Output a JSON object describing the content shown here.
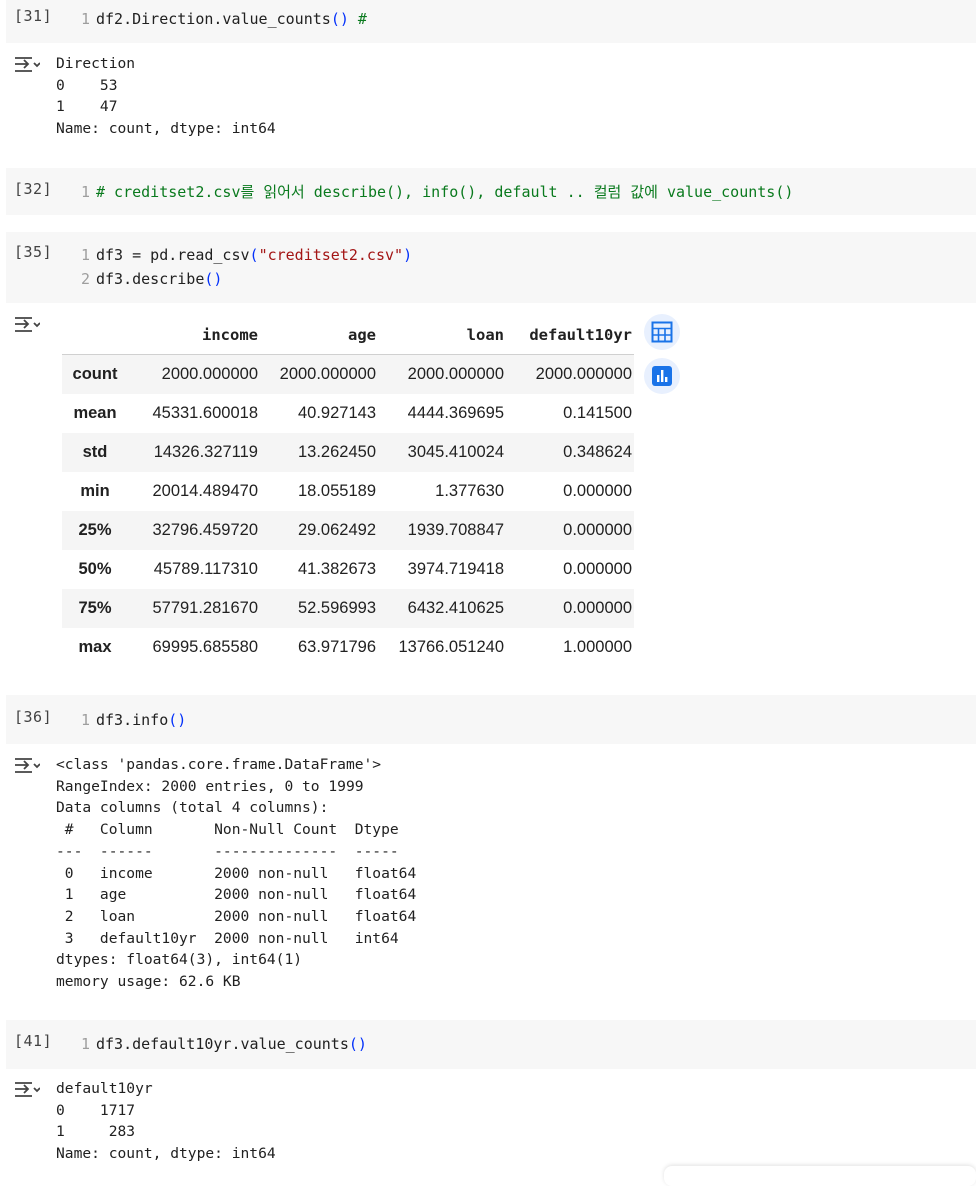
{
  "cells": [
    {
      "id": "c31",
      "exec_count": "[31]",
      "code": [
        {
          "n": "1",
          "parts": [
            {
              "t": "df2.Direction.value_counts",
              "c": ""
            },
            {
              "t": "()",
              "c": "paren"
            },
            {
              "t": " #",
              "c": "cm"
            }
          ]
        }
      ],
      "output": "Direction\n0    53\n1    47\nName: count, dtype: int64"
    },
    {
      "id": "c32",
      "exec_count": "[32]",
      "code": [
        {
          "n": "1",
          "parts": [
            {
              "t": "# creditset2.csv를 읽어서 describe(), info(), default .. 컬럼 값에 value_counts()",
              "c": "cm"
            }
          ]
        }
      ]
    },
    {
      "id": "c35",
      "exec_count": "[35]",
      "code": [
        {
          "n": "1",
          "parts": [
            {
              "t": "df3 = pd.read_csv",
              "c": ""
            },
            {
              "t": "(",
              "c": "paren"
            },
            {
              "t": "\"creditset2.csv\"",
              "c": "str"
            },
            {
              "t": ")",
              "c": "paren"
            }
          ]
        },
        {
          "n": "2",
          "parts": [
            {
              "t": "df3.describe",
              "c": ""
            },
            {
              "t": "()",
              "c": "paren"
            }
          ]
        }
      ],
      "table": {
        "columns": [
          "income",
          "age",
          "loan",
          "default10yr"
        ],
        "rows": [
          {
            "label": "count",
            "values": [
              "2000.000000",
              "2000.000000",
              "2000.000000",
              "2000.000000"
            ]
          },
          {
            "label": "mean",
            "values": [
              "45331.600018",
              "40.927143",
              "4444.369695",
              "0.141500"
            ]
          },
          {
            "label": "std",
            "values": [
              "14326.327119",
              "13.262450",
              "3045.410024",
              "0.348624"
            ]
          },
          {
            "label": "min",
            "values": [
              "20014.489470",
              "18.055189",
              "1.377630",
              "0.000000"
            ]
          },
          {
            "label": "25%",
            "values": [
              "32796.459720",
              "29.062492",
              "1939.708847",
              "0.000000"
            ]
          },
          {
            "label": "50%",
            "values": [
              "45789.117310",
              "41.382673",
              "3974.719418",
              "0.000000"
            ]
          },
          {
            "label": "75%",
            "values": [
              "57791.281670",
              "52.596993",
              "6432.410625",
              "0.000000"
            ]
          },
          {
            "label": "max",
            "values": [
              "69995.685580",
              "63.971796",
              "13766.051240",
              "1.000000"
            ]
          }
        ]
      },
      "buttons": {
        "table_icon": "table-icon",
        "chart_icon": "bar-chart-icon"
      }
    },
    {
      "id": "c36",
      "exec_count": "[36]",
      "code": [
        {
          "n": "1",
          "parts": [
            {
              "t": "df3.info",
              "c": ""
            },
            {
              "t": "()",
              "c": "paren"
            }
          ]
        }
      ],
      "output": "<class 'pandas.core.frame.DataFrame'>\nRangeIndex: 2000 entries, 0 to 1999\nData columns (total 4 columns):\n #   Column       Non-Null Count  Dtype  \n---  ------       --------------  -----  \n 0   income       2000 non-null   float64\n 1   age          2000 non-null   float64\n 2   loan         2000 non-null   float64\n 3   default10yr  2000 non-null   int64  \ndtypes: float64(3), int64(1)\nmemory usage: 62.6 KB"
    },
    {
      "id": "c41",
      "exec_count": "[41]",
      "code": [
        {
          "n": "1",
          "parts": [
            {
              "t": "df3.default10yr.value_counts",
              "c": ""
            },
            {
              "t": "()",
              "c": "paren"
            }
          ]
        }
      ],
      "output": "default10yr\n0    1717\n1     283\nName: count, dtype: int64"
    }
  ],
  "colors": {
    "code_bg": "#f7f7f7",
    "comment": "#0a7a1e",
    "string": "#a31515",
    "paren": "#0431fa",
    "icon_blue": "#1a73e8"
  }
}
